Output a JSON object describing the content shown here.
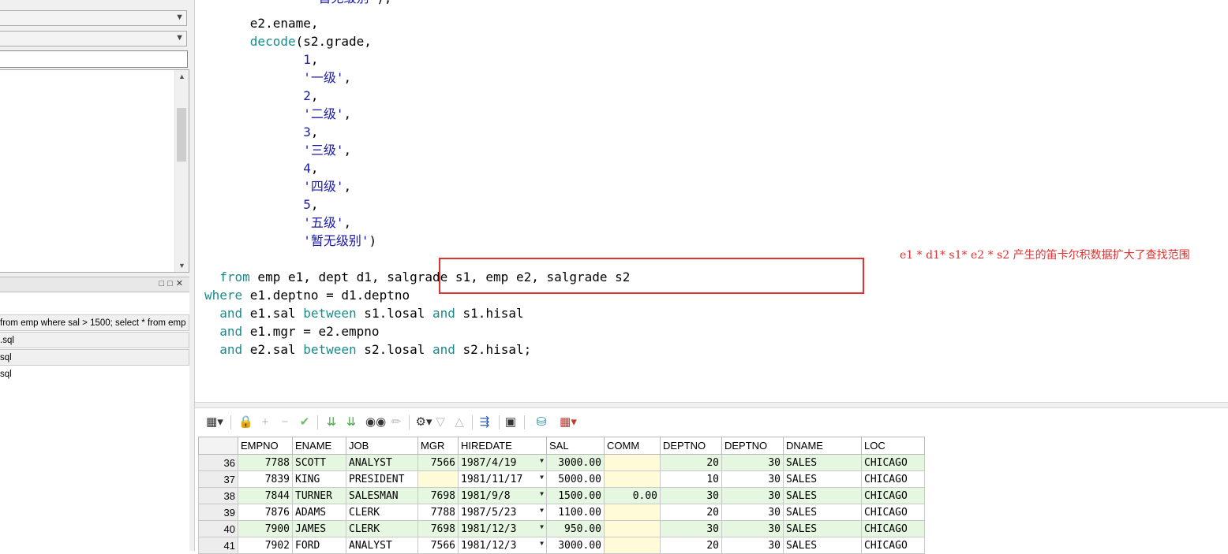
{
  "left_panel": {
    "history_items": [
      "from emp where sal > 1500; select * from emp",
      ".sql",
      "sql",
      "sql"
    ]
  },
  "editor": {
    "lines": [
      {
        "indent": "              ",
        "tokens": [
          {
            "t": "'暂无级别'",
            "c": "str"
          },
          {
            "t": "),",
            "c": ""
          }
        ]
      },
      {
        "indent": "      ",
        "tokens": [
          {
            "t": "e2.ename,",
            "c": ""
          }
        ]
      },
      {
        "indent": "      ",
        "tokens": [
          {
            "t": "decode",
            "c": "fn"
          },
          {
            "t": "(s2.grade,",
            "c": ""
          }
        ]
      },
      {
        "indent": "             ",
        "tokens": [
          {
            "t": "1",
            "c": "num"
          },
          {
            "t": ",",
            "c": ""
          }
        ]
      },
      {
        "indent": "             ",
        "tokens": [
          {
            "t": "'一级'",
            "c": "str"
          },
          {
            "t": ",",
            "c": ""
          }
        ]
      },
      {
        "indent": "             ",
        "tokens": [
          {
            "t": "2",
            "c": "num"
          },
          {
            "t": ",",
            "c": ""
          }
        ]
      },
      {
        "indent": "             ",
        "tokens": [
          {
            "t": "'二级'",
            "c": "str"
          },
          {
            "t": ",",
            "c": ""
          }
        ]
      },
      {
        "indent": "             ",
        "tokens": [
          {
            "t": "3",
            "c": "num"
          },
          {
            "t": ",",
            "c": ""
          }
        ]
      },
      {
        "indent": "             ",
        "tokens": [
          {
            "t": "'三级'",
            "c": "str"
          },
          {
            "t": ",",
            "c": ""
          }
        ]
      },
      {
        "indent": "             ",
        "tokens": [
          {
            "t": "4",
            "c": "num"
          },
          {
            "t": ",",
            "c": ""
          }
        ]
      },
      {
        "indent": "             ",
        "tokens": [
          {
            "t": "'四级'",
            "c": "str"
          },
          {
            "t": ",",
            "c": ""
          }
        ]
      },
      {
        "indent": "             ",
        "tokens": [
          {
            "t": "5",
            "c": "num"
          },
          {
            "t": ",",
            "c": ""
          }
        ]
      },
      {
        "indent": "             ",
        "tokens": [
          {
            "t": "'五级'",
            "c": "str"
          },
          {
            "t": ",",
            "c": ""
          }
        ]
      },
      {
        "indent": "             ",
        "tokens": [
          {
            "t": "'暂无级别'",
            "c": "str"
          },
          {
            "t": ")",
            "c": ""
          }
        ]
      },
      {
        "indent": "",
        "tokens": []
      },
      {
        "indent": "  ",
        "tokens": [
          {
            "t": "from",
            "c": "kw"
          },
          {
            "t": " emp e1, dept d1, salgrade s1, emp e2, salgrade s2",
            "c": ""
          }
        ]
      },
      {
        "indent": "",
        "tokens": [
          {
            "t": "where",
            "c": "kw"
          },
          {
            "t": " e1.deptno = d1.deptno",
            "c": ""
          }
        ]
      },
      {
        "indent": "  ",
        "tokens": [
          {
            "t": "and",
            "c": "kw"
          },
          {
            "t": " e1.sal ",
            "c": ""
          },
          {
            "t": "between",
            "c": "kw"
          },
          {
            "t": " s1.losal ",
            "c": ""
          },
          {
            "t": "and",
            "c": "kw"
          },
          {
            "t": " s1.hisal",
            "c": ""
          }
        ]
      },
      {
        "indent": "  ",
        "tokens": [
          {
            "t": "and",
            "c": "kw"
          },
          {
            "t": " e1.mgr = e2.empno",
            "c": ""
          }
        ]
      },
      {
        "indent": "  ",
        "tokens": [
          {
            "t": "and",
            "c": "kw"
          },
          {
            "t": " e2.sal ",
            "c": ""
          },
          {
            "t": "between",
            "c": "kw"
          },
          {
            "t": " s2.losal ",
            "c": ""
          },
          {
            "t": "and",
            "c": "kw"
          },
          {
            "t": " s2.hisal;",
            "c": ""
          }
        ]
      }
    ],
    "annotation": "e1 * d1* s1* e2 * s2 产生的笛卡尔积数据扩大了查找范围"
  },
  "grid": {
    "columns": [
      "EMPNO",
      "ENAME",
      "JOB",
      "MGR",
      "HIREDATE",
      "SAL",
      "COMM",
      "DEPTNO",
      "DEPTNO",
      "DNAME",
      "LOC"
    ],
    "rows": [
      {
        "n": "36",
        "empno": "7788",
        "ename": "SCOTT",
        "job": "ANALYST",
        "mgr": "7566",
        "hiredate": "1987/4/19",
        "sal": "3000.00",
        "comm": "",
        "deptno": "20",
        "deptno2": "30",
        "dname": "SALES",
        "loc": "CHICAGO"
      },
      {
        "n": "37",
        "empno": "7839",
        "ename": "KING",
        "job": "PRESIDENT",
        "mgr": "",
        "hiredate": "1981/11/17",
        "sal": "5000.00",
        "comm": "",
        "deptno": "10",
        "deptno2": "30",
        "dname": "SALES",
        "loc": "CHICAGO"
      },
      {
        "n": "38",
        "empno": "7844",
        "ename": "TURNER",
        "job": "SALESMAN",
        "mgr": "7698",
        "hiredate": "1981/9/8",
        "sal": "1500.00",
        "comm": "0.00",
        "deptno": "30",
        "deptno2": "30",
        "dname": "SALES",
        "loc": "CHICAGO"
      },
      {
        "n": "39",
        "empno": "7876",
        "ename": "ADAMS",
        "job": "CLERK",
        "mgr": "7788",
        "hiredate": "1987/5/23",
        "sal": "1100.00",
        "comm": "",
        "deptno": "20",
        "deptno2": "30",
        "dname": "SALES",
        "loc": "CHICAGO"
      },
      {
        "n": "40",
        "empno": "7900",
        "ename": "JAMES",
        "job": "CLERK",
        "mgr": "7698",
        "hiredate": "1981/12/3",
        "sal": "950.00",
        "comm": "",
        "deptno": "30",
        "deptno2": "30",
        "dname": "SALES",
        "loc": "CHICAGO"
      },
      {
        "n": "41",
        "empno": "7902",
        "ename": "FORD",
        "job": "ANALYST",
        "mgr": "7566",
        "hiredate": "1981/12/3",
        "sal": "3000.00",
        "comm": "",
        "deptno": "20",
        "deptno2": "30",
        "dname": "SALES",
        "loc": "CHICAGO"
      }
    ]
  },
  "colors": {
    "keyword": "#1b8a8a",
    "literal": "#1a1aa6",
    "highlight_box": "#e03030",
    "row_alt": "#e6f7e1",
    "null_cell": "#fffbd8"
  },
  "icons": [
    "grid-options-icon",
    "lock-icon",
    "add-record-icon",
    "delete-record-icon",
    "post-changes-icon",
    "next-page-icon",
    "last-page-icon",
    "find-icon",
    "clear-icon",
    "query-by-example-icon",
    "filter-icon",
    "sort-icon",
    "export-icon",
    "save-icon",
    "db-icon",
    "chart-icon"
  ]
}
